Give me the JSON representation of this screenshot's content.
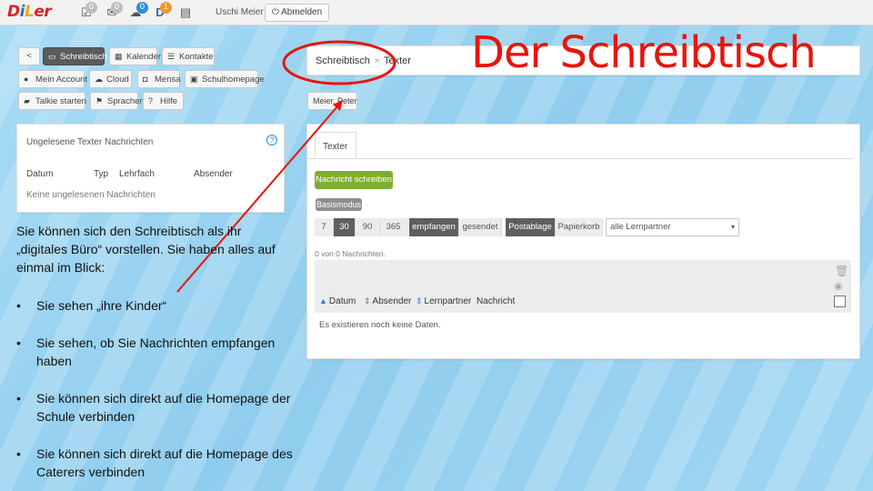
{
  "app": {
    "logo_parts": [
      "D",
      "i",
      "L",
      "er"
    ],
    "badges": [
      "0",
      "0",
      "0",
      "1"
    ],
    "user_name": "Uschi Meier",
    "logout_label": "Abmelden"
  },
  "slide": {
    "title": "Der Schreibtisch",
    "intro": "Sie können sich den Schreibtisch als ihr „digitales Büro“ vorstellen. Sie haben alles auf einmal im Blick:",
    "bullets": [
      "Sie sehen „ihre Kinder“",
      "Sie sehen, ob Sie Nachrichten empfangen haben",
      "Sie können sich direkt auf die Homepage der Schule verbinden",
      "Sie können sich direkt auf die Homepage des Caterers verbinden"
    ],
    "accent_color": "#e8140a"
  },
  "nav": {
    "back": "<",
    "row1": [
      "Schreibtisch",
      "Kalender",
      "Kontakte"
    ],
    "row2": [
      "Mein Account",
      "Cloud",
      "Mensa",
      "Schulhomepage"
    ],
    "row3": [
      "Talkie starten",
      "Sprachen",
      "Hilfe"
    ]
  },
  "unread_panel": {
    "title": "Ungelesene Texter Nachrichten",
    "help": "?",
    "columns": [
      "Datum",
      "Typ",
      "Lehrfach",
      "Absender"
    ],
    "empty": "Keine ungelesenen Nachrichten"
  },
  "breadcrumb": {
    "parent": "Schreibtisch",
    "sep": "»",
    "current": "Texter"
  },
  "child_button": "Meier, Peter",
  "texter": {
    "tab": "Texter",
    "compose": "Nachricht schreiben",
    "mode": "Basismodus",
    "ranges": [
      "7",
      "30",
      "90",
      "365"
    ],
    "filters": [
      "empfangen",
      "gesendet"
    ],
    "folders": [
      "Postablage",
      "Papierkorb"
    ],
    "partner_select": "alle Lernpartner",
    "count": "0 von 0 Nachrichten.",
    "columns": [
      "Datum",
      "Absender",
      "Lernpartner",
      "Nachricht"
    ],
    "empty": "Es existieren noch keine Daten."
  }
}
